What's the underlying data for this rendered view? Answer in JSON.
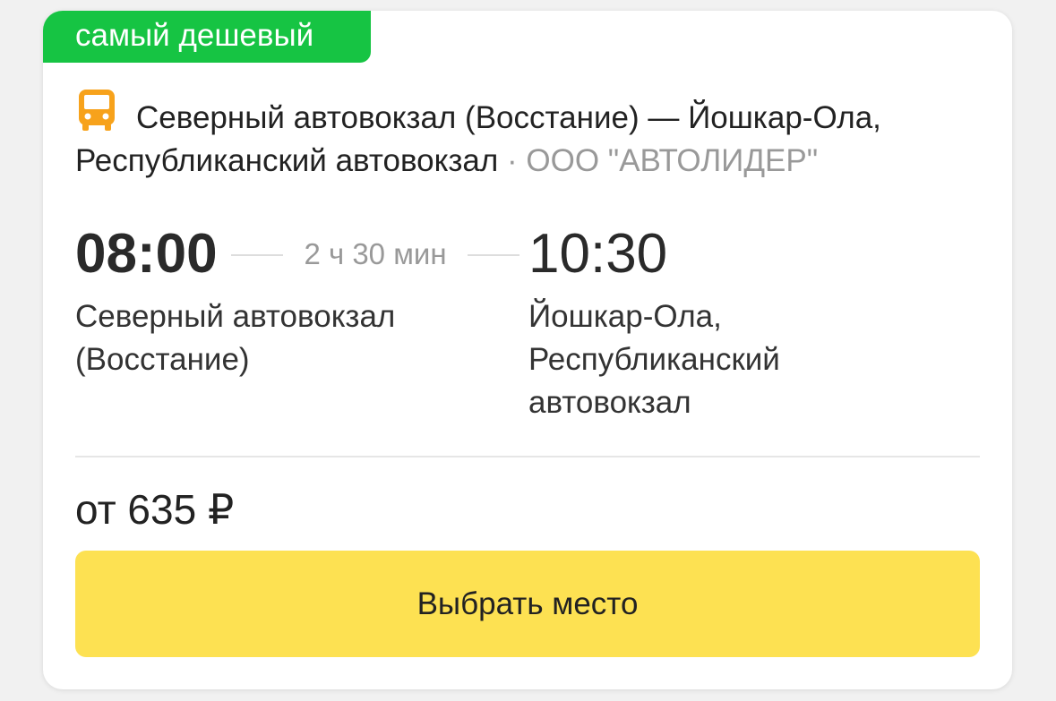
{
  "badge": {
    "label": "самый дешевый",
    "color": "#16c443"
  },
  "route": {
    "title": "Северный автовокзал (Восстание) — Йошкар-Ола, Республиканский автовокзал",
    "separator": " · ",
    "carrier": "ООО \"АВТОЛИДЕР\"",
    "icon": "bus-icon",
    "icon_color": "#f7a21b"
  },
  "trip": {
    "departure_time": "08:00",
    "duration": "2 ч 30 мин",
    "arrival_time": "10:30",
    "departure_station": "Северный автовокзал (Восстание)",
    "arrival_station": "Йошкар-Ола, Республиканский автовокзал"
  },
  "price": {
    "label": "от 635 ₽"
  },
  "action": {
    "select_label": "Выбрать место",
    "color": "#fde152"
  }
}
